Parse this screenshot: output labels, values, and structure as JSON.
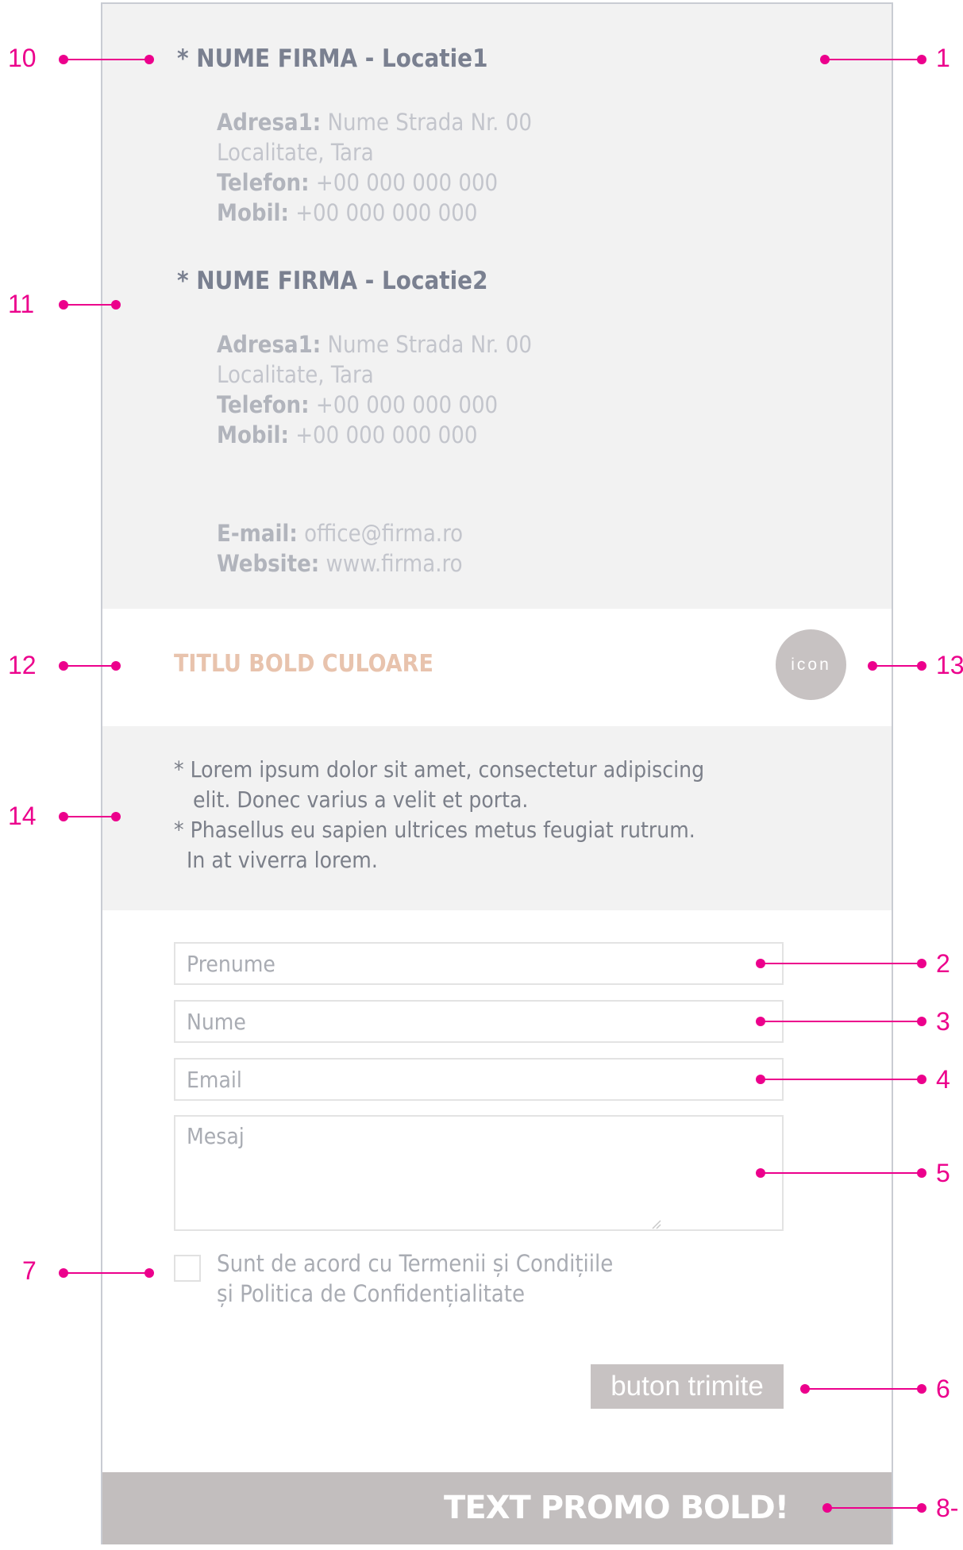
{
  "locations": [
    {
      "title": "* NUME FIRMA - Locatie1",
      "address_label": "Adresa1:",
      "address_value": "Nume Strada Nr. 00",
      "city": "Localitate, Tara",
      "phone_label": "Telefon:",
      "phone_value": "+00 000 000 000",
      "mobile_label": "Mobil:",
      "mobile_value": "+00 000 000 000"
    },
    {
      "title": "* NUME FIRMA - Locatie2",
      "address_label": "Adresa1:",
      "address_value": "Nume Strada Nr. 00",
      "city": "Localitate, Tara",
      "phone_label": "Telefon:",
      "phone_value": "+00 000 000 000",
      "mobile_label": "Mobil:",
      "mobile_value": "+00 000 000 000"
    }
  ],
  "contact": {
    "email_label": "E-mail:",
    "email_value": "office@firma.ro",
    "website_label": "Website:",
    "website_value": "www.firma.ro"
  },
  "section": {
    "title": "TITLU BOLD CULOARE",
    "icon_text": "icon",
    "icon_color": "#c7c2c2",
    "title_color": "#e8c3ad"
  },
  "lorem": {
    "text": "* Lorem ipsum dolor sit amet, consectetur adipiscing\n   elit. Donec varius a velit et porta.\n* Phasellus eu sapien ultrices metus feugiat rutrum.\n  In at viverra lorem."
  },
  "form": {
    "firstname_placeholder": "Prenume",
    "lastname_placeholder": "Nume",
    "email_placeholder": "Email",
    "message_placeholder": "Mesaj",
    "consent_line1": "Sunt de acord cu Termenii și Condițiile",
    "consent_line2": "și Politica de Confidențialitate",
    "submit_label": "buton trimite"
  },
  "promo": {
    "text": "TEXT PROMO BOLD!"
  },
  "annotations": {
    "accent_color": "#ec008c",
    "left": [
      "10",
      "11",
      "12",
      "14",
      "7"
    ],
    "right": [
      "1",
      "13",
      "2",
      "3",
      "4",
      "5",
      "6",
      "8-"
    ]
  }
}
